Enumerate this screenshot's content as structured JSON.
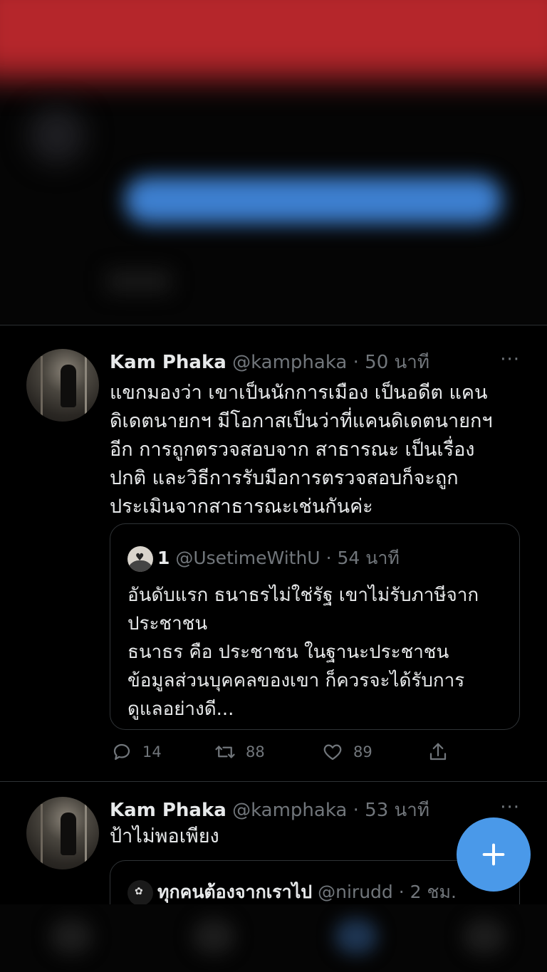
{
  "tweets": [
    {
      "name": "Kam Phaka",
      "handle": "@kamphaka",
      "separator": "·",
      "time": "50 นาที",
      "more": "···",
      "text": "แขกมองว่า เขาเป็นนักการเมือง เป็นอดีต แคน\nดิเดตนายกฯ มีโอกาสเป็นว่าที่แคนดิเดตนายกฯ\nอีก การถูกตรวจสอบจาก สาธารณะ เป็นเรื่อง\nปกติ และวิธีการรับมือการตรวจสอบก็จะถูก\nประเมินจากสาธารณะเช่นกันค่ะ",
      "quote": {
        "name": "1",
        "handle": "@UsetimeWithU",
        "separator": "·",
        "time": "54 นาที",
        "text": "อันดับแรก ธนาธรไม่ใช่รัฐ เขาไม่รับภาษีจาก\nประชาชน\nธนาธร คือ ประชาชน ในฐานะประชาชน\nข้อมูลส่วนบุคคลของเขา ก็ควรจะได้รับการ\nดูแลอย่างดี..."
      },
      "stats": {
        "replies": "14",
        "retweets": "88",
        "likes": "89"
      }
    },
    {
      "name": "Kam Phaka",
      "handle": "@kamphaka",
      "separator": "·",
      "time": "53 นาที",
      "more": "···",
      "text": "ป้าไม่พอเพียง",
      "quote": {
        "name": "ทุกคนต้องจากเราไป",
        "handle": "@nirudd",
        "separator": "·",
        "time": "2 ชม."
      }
    }
  ],
  "fab": {
    "icon": "compose-plus-icon"
  },
  "colors": {
    "accent": "#4a99e9",
    "muted": "#71767b",
    "divider": "#2f3336"
  }
}
